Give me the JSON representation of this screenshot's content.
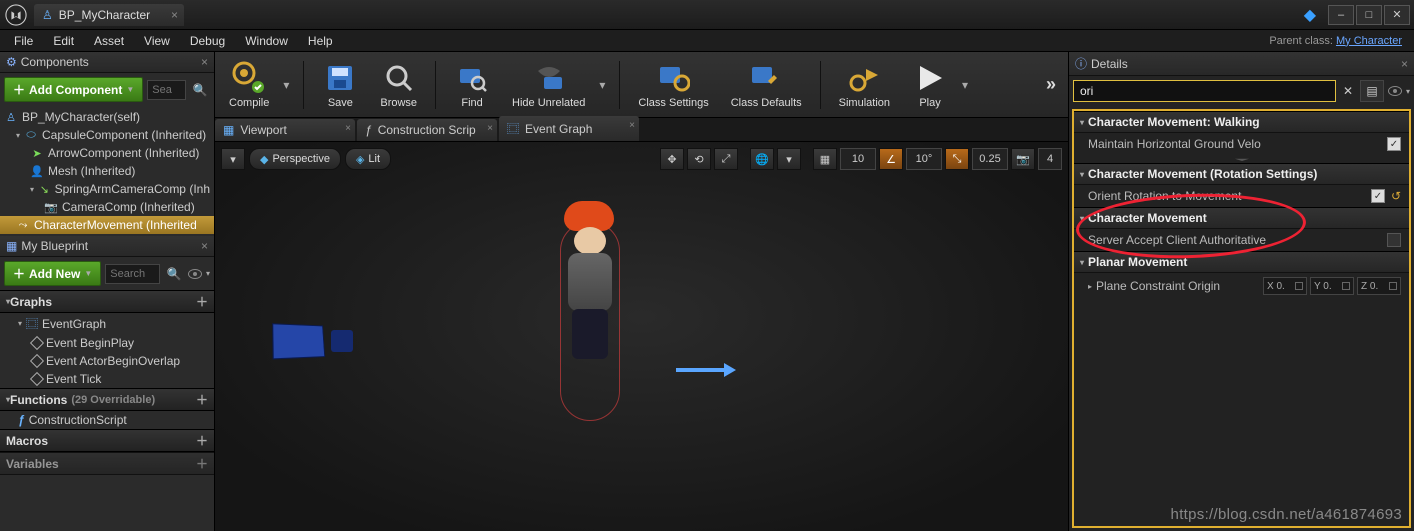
{
  "titleTab": {
    "label": "BP_MyCharacter"
  },
  "windowControls": {
    "min": "–",
    "max": "□",
    "close": "✕"
  },
  "menu": [
    "File",
    "Edit",
    "Asset",
    "View",
    "Debug",
    "Window",
    "Help"
  ],
  "parentClassLabel": "Parent class:",
  "parentClassLink": "My Character",
  "leftPanels": {
    "components": {
      "title": "Components",
      "addLabel": "Add Component",
      "searchPlaceholder": "Sea",
      "tree": [
        "BP_MyCharacter(self)",
        "CapsuleComponent (Inherited)",
        "ArrowComponent (Inherited)",
        "Mesh (Inherited)",
        "SpringArmCameraComp (Inh",
        "CameraComp (Inherited)",
        "CharacterMovement (Inherited"
      ]
    },
    "myBlueprint": {
      "title": "My Blueprint",
      "addLabel": "Add New",
      "searchPlaceholder": "Search",
      "graphsHeader": "Graphs",
      "eventGraphLabel": "EventGraph",
      "events": [
        "Event BeginPlay",
        "Event ActorBeginOverlap",
        "Event Tick"
      ],
      "functionsHeader": "Functions",
      "functionsCount": "(29 Overridable)",
      "functions": [
        "ConstructionScript"
      ],
      "macrosHeader": "Macros",
      "variablesHeader": "Variables"
    }
  },
  "toolbar": {
    "compile": "Compile",
    "save": "Save",
    "browse": "Browse",
    "find": "Find",
    "hideUnrelated": "Hide Unrelated",
    "classSettings": "Class Settings",
    "classDefaults": "Class Defaults",
    "simulation": "Simulation",
    "play": "Play"
  },
  "subtabs": {
    "viewport": "Viewport",
    "construction": "Construction Scrip",
    "eventGraph": "Event Graph"
  },
  "viewport": {
    "perspective": "Perspective",
    "lit": "Lit",
    "transformSnap": "10",
    "angleSnap": "10°",
    "scaleSnap": "0.25",
    "camSpeed": "4"
  },
  "details": {
    "title": "Details",
    "search": "ori",
    "catWalking": "Character Movement: Walking",
    "maintainHoriz": "Maintain Horizontal Ground Velo",
    "catRotation": "Character Movement (Rotation Settings)",
    "orientRotation": "Orient Rotation to Movement",
    "catCharMove": "Character Movement",
    "serverAccept": "Server Accept Client Authoritative",
    "catPlanar": "Planar Movement",
    "planeConstraint": "Plane Constraint Origin",
    "vecX": "X 0.",
    "vecY": "Y 0.",
    "vecZ": "Z 0."
  },
  "watermark": "https://blog.csdn.net/a461874693"
}
